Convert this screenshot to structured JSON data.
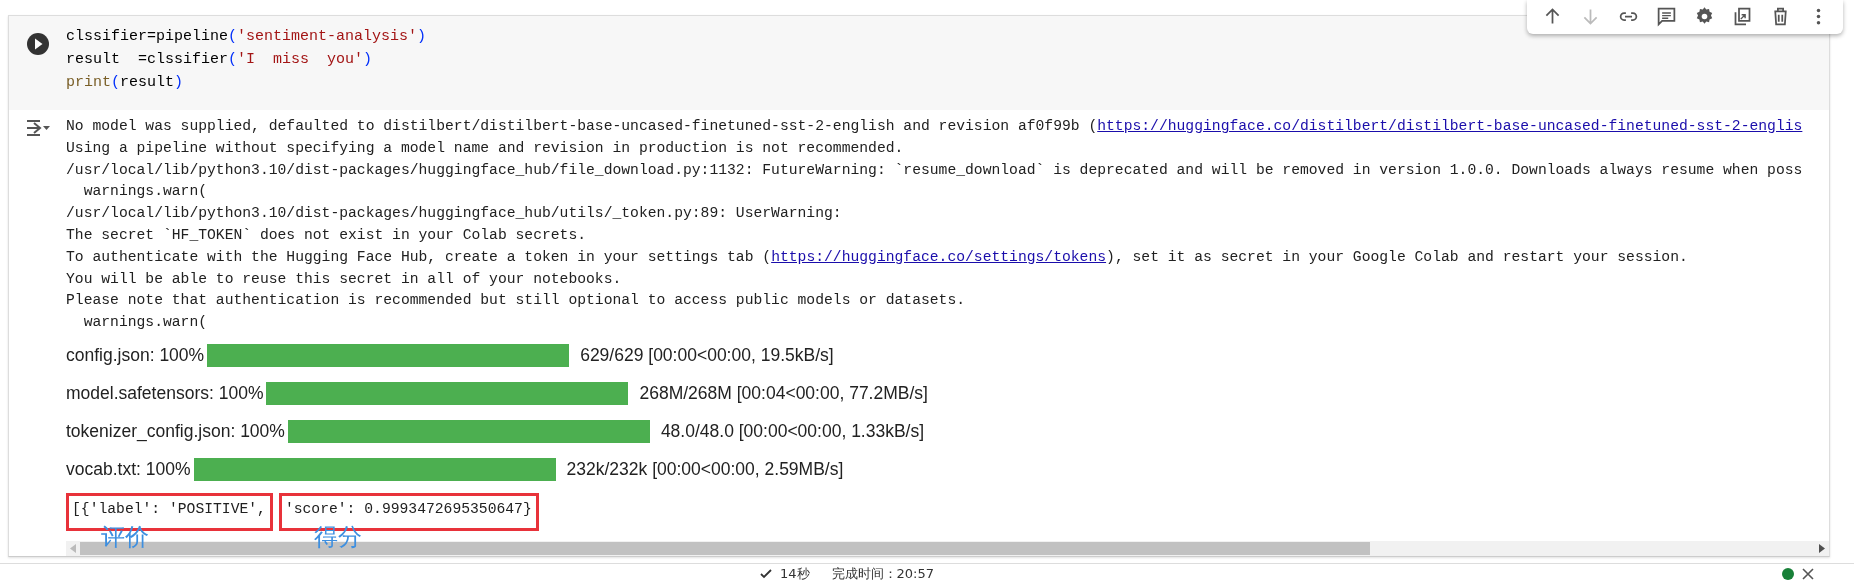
{
  "toolbar": [
    {
      "kind": "up",
      "disabled": false
    },
    {
      "kind": "down",
      "disabled": true
    },
    {
      "kind": "link",
      "disabled": false
    },
    {
      "kind": "comment",
      "disabled": false
    },
    {
      "kind": "settings",
      "disabled": false
    },
    {
      "kind": "mirror",
      "disabled": false
    },
    {
      "kind": "delete",
      "disabled": false
    },
    {
      "kind": "more",
      "disabled": false
    }
  ],
  "code": [
    [
      {
        "text": "clssifier=pipeline",
        "kind": "plain"
      },
      {
        "text": "(",
        "kind": "paren"
      },
      {
        "text": "'sentiment-analysis'",
        "kind": "string"
      },
      {
        "text": ")",
        "kind": "paren"
      }
    ],
    [
      {
        "text": "result  =clssifier",
        "kind": "plain"
      },
      {
        "text": "(",
        "kind": "paren"
      },
      {
        "text": "'I  miss  you'",
        "kind": "string"
      },
      {
        "text": ")",
        "kind": "paren"
      }
    ],
    [
      {
        "text": "print",
        "kind": "func"
      },
      {
        "text": "(",
        "kind": "paren"
      },
      {
        "text": "result",
        "kind": "plain"
      },
      {
        "text": ")",
        "kind": "paren"
      }
    ]
  ],
  "output": [
    [
      {
        "text": "No model was supplied, defaulted to distilbert/distilbert-base-uncased-finetuned-sst-2-english and revision af0f99b (",
        "kind": "text"
      },
      {
        "text": "https://huggingface.co/distilbert/distilbert-base-uncased-finetuned-sst-2-englis",
        "kind": "link"
      }
    ],
    [
      {
        "text": "Using a pipeline without specifying a model name and revision in production is not recommended.",
        "kind": "text"
      }
    ],
    [
      {
        "text": "/usr/local/lib/python3.10/dist-packages/huggingface_hub/file_download.py:1132: FutureWarning: `resume_download` is deprecated and will be removed in version 1.0.0. Downloads always resume when poss",
        "kind": "text"
      }
    ],
    [
      {
        "text": "  warnings.warn(",
        "kind": "text"
      }
    ],
    [
      {
        "text": "/usr/local/lib/python3.10/dist-packages/huggingface_hub/utils/_token.py:89: UserWarning:",
        "kind": "text"
      }
    ],
    [
      {
        "text": "The secret `HF_TOKEN` does not exist in your Colab secrets.",
        "kind": "text"
      }
    ],
    [
      {
        "text": "To authenticate with the Hugging Face Hub, create a token in your settings tab (",
        "kind": "text"
      },
      {
        "text": "https://huggingface.co/settings/tokens",
        "kind": "link"
      },
      {
        "text": "), set it as secret in your Google Colab and restart your session.",
        "kind": "text"
      }
    ],
    [
      {
        "text": "You will be able to reuse this secret in all of your notebooks.",
        "kind": "text"
      }
    ],
    [
      {
        "text": "Please note that authentication is recommended but still optional to access public models or datasets.",
        "kind": "text"
      }
    ],
    [
      {
        "text": "  warnings.warn(",
        "kind": "text"
      }
    ]
  ],
  "progress": [
    {
      "label": "config.json: 100%",
      "level": 1,
      "stats": "629/629 [00:00<00:00, 19.5kB/s]"
    },
    {
      "label": "model.safetensors: 100%",
      "level": 1,
      "stats": "268M/268M [00:04<00:00, 77.2MB/s]"
    },
    {
      "label": "tokenizer_config.json: 100%",
      "level": 1,
      "stats": "48.0/48.0 [00:00<00:00, 1.33kB/s]"
    },
    {
      "label": "vocab.txt: 100%",
      "level": 1,
      "stats": "232k/232k [00:00<00:00, 2.59MB/s]"
    }
  ],
  "result": [
    {
      "text": "[{'label': 'POSITIVE',",
      "note": "评价"
    },
    {
      "text": "'score': 0.9993472695350647}",
      "note": "得分"
    }
  ],
  "status": {
    "duration": "14秒",
    "finished": "完成时间：20:57"
  }
}
